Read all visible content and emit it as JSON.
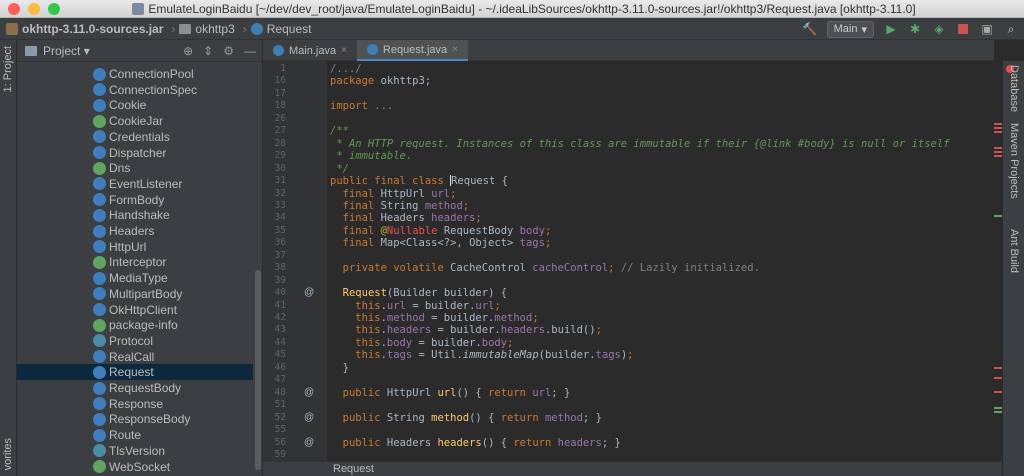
{
  "window": {
    "title": "EmulateLoginBaidu [~/dev/dev_root/java/EmulateLoginBaidu] - ~/.ideaLibSources/okhttp-3.11.0-sources.jar!/okhttp3/Request.java [okhttp-3.11.0]",
    "traffic_colors": [
      "#fc605c",
      "#fdbc40",
      "#34c84a"
    ]
  },
  "breadcrumbs": [
    "okhttp-3.11.0-sources.jar",
    "okhttp3",
    "Request"
  ],
  "toolbar": {
    "run_config": "Main",
    "icons": [
      "hammer-icon",
      "run-icon",
      "debug-icon",
      "coverage-icon",
      "stop-icon",
      "layout-icon",
      "search-icon"
    ]
  },
  "left_strip": {
    "project_tab": "1: Project",
    "favorites_tab": "vorites"
  },
  "project_panel": {
    "title": "Project",
    "items": [
      {
        "label": "ConnectionPool",
        "icon": "class-icon"
      },
      {
        "label": "ConnectionSpec",
        "icon": "class-icon"
      },
      {
        "label": "Cookie",
        "icon": "class-icon"
      },
      {
        "label": "CookieJar",
        "icon": "interface-icon"
      },
      {
        "label": "Credentials",
        "icon": "class-icon"
      },
      {
        "label": "Dispatcher",
        "icon": "class-icon"
      },
      {
        "label": "Dns",
        "icon": "interface-icon"
      },
      {
        "label": "EventListener",
        "icon": "class-icon"
      },
      {
        "label": "FormBody",
        "icon": "class-icon"
      },
      {
        "label": "Handshake",
        "icon": "class-icon"
      },
      {
        "label": "Headers",
        "icon": "class-icon"
      },
      {
        "label": "HttpUrl",
        "icon": "class-icon"
      },
      {
        "label": "Interceptor",
        "icon": "interface-icon"
      },
      {
        "label": "MediaType",
        "icon": "class-icon"
      },
      {
        "label": "MultipartBody",
        "icon": "class-icon"
      },
      {
        "label": "OkHttpClient",
        "icon": "class-icon"
      },
      {
        "label": "package-info",
        "icon": "interface-icon"
      },
      {
        "label": "Protocol",
        "icon": "enum-icon"
      },
      {
        "label": "RealCall",
        "icon": "class-icon"
      },
      {
        "label": "Request",
        "icon": "class-icon",
        "selected": true
      },
      {
        "label": "RequestBody",
        "icon": "class-icon"
      },
      {
        "label": "Response",
        "icon": "class-icon"
      },
      {
        "label": "ResponseBody",
        "icon": "class-icon"
      },
      {
        "label": "Route",
        "icon": "class-icon"
      },
      {
        "label": "TlsVersion",
        "icon": "enum-icon"
      },
      {
        "label": "WebSocket",
        "icon": "interface-icon"
      }
    ]
  },
  "tabs": [
    {
      "label": "Main.java",
      "active": false
    },
    {
      "label": "Request.java",
      "active": true
    }
  ],
  "editor": {
    "lines": [
      {
        "n": "1",
        "gutter": "",
        "tokens": [
          {
            "t": "/.../",
            "c": "cm"
          }
        ]
      },
      {
        "n": "16",
        "gutter": "",
        "tokens": [
          {
            "t": "package ",
            "c": "kw"
          },
          {
            "t": "okhttp3;",
            "c": ""
          }
        ]
      },
      {
        "n": "17",
        "gutter": "",
        "tokens": []
      },
      {
        "n": "18",
        "gutter": "",
        "tokens": [
          {
            "t": "import ",
            "c": "kw"
          },
          {
            "t": "...",
            "c": "cm"
          }
        ]
      },
      {
        "n": "26",
        "gutter": "",
        "tokens": []
      },
      {
        "n": "27",
        "gutter": "",
        "tokens": [
          {
            "t": "/**",
            "c": "doc"
          }
        ]
      },
      {
        "n": "28",
        "gutter": "",
        "tokens": [
          {
            "t": " * An HTTP request. Instances of this class are immutable if their {",
            "c": "doc"
          },
          {
            "t": "@link",
            "c": "doc"
          },
          {
            "t": " #body} is null or itself",
            "c": "doc"
          }
        ]
      },
      {
        "n": "29",
        "gutter": "",
        "tokens": [
          {
            "t": " * immutable.",
            "c": "doc"
          }
        ]
      },
      {
        "n": "30",
        "gutter": "",
        "tokens": [
          {
            "t": " */",
            "c": "doc"
          }
        ]
      },
      {
        "n": "31",
        "gutter": "",
        "tokens": [
          {
            "t": "public final class ",
            "c": "kw"
          },
          {
            "t": "Request {",
            "c": "caret"
          }
        ]
      },
      {
        "n": "32",
        "gutter": "",
        "tokens": [
          {
            "t": "  final ",
            "c": "kw"
          },
          {
            "t": "HttpUrl ",
            "c": ""
          },
          {
            "t": "url",
            "c": "fld"
          },
          {
            "t": ";",
            "c": "kw"
          }
        ]
      },
      {
        "n": "33",
        "gutter": "",
        "tokens": [
          {
            "t": "  final ",
            "c": "kw"
          },
          {
            "t": "String ",
            "c": ""
          },
          {
            "t": "method",
            "c": "fld"
          },
          {
            "t": ";",
            "c": "kw"
          }
        ]
      },
      {
        "n": "34",
        "gutter": "",
        "tokens": [
          {
            "t": "  final ",
            "c": "kw"
          },
          {
            "t": "Headers ",
            "c": ""
          },
          {
            "t": "headers",
            "c": "fld"
          },
          {
            "t": ";",
            "c": "kw"
          }
        ]
      },
      {
        "n": "35",
        "gutter": "",
        "tokens": [
          {
            "t": "  final ",
            "c": "kw"
          },
          {
            "t": "@",
            "c": "ann"
          },
          {
            "t": "Nullable ",
            "c": "err"
          },
          {
            "t": "RequestBody ",
            "c": ""
          },
          {
            "t": "body",
            "c": "fld"
          },
          {
            "t": ";",
            "c": "kw"
          }
        ]
      },
      {
        "n": "36",
        "gutter": "",
        "tokens": [
          {
            "t": "  final ",
            "c": "kw"
          },
          {
            "t": "Map<Class<?>, Object> ",
            "c": ""
          },
          {
            "t": "tags",
            "c": "fld"
          },
          {
            "t": ";",
            "c": "kw"
          }
        ]
      },
      {
        "n": "37",
        "gutter": "",
        "tokens": []
      },
      {
        "n": "38",
        "gutter": "",
        "tokens": [
          {
            "t": "  private volatile ",
            "c": "kw"
          },
          {
            "t": "CacheControl ",
            "c": ""
          },
          {
            "t": "cacheControl",
            "c": "fld"
          },
          {
            "t": "; ",
            "c": "kw"
          },
          {
            "t": "// Lazily initialized.",
            "c": "cm"
          }
        ]
      },
      {
        "n": "39",
        "gutter": "",
        "tokens": []
      },
      {
        "n": "40",
        "gutter": "@",
        "tokens": [
          {
            "t": "  ",
            "c": ""
          },
          {
            "t": "Request",
            "c": "fn"
          },
          {
            "t": "(Builder builder) {",
            "c": ""
          }
        ]
      },
      {
        "n": "41",
        "gutter": "",
        "tokens": [
          {
            "t": "    this",
            "c": "kw"
          },
          {
            "t": ".",
            "c": ""
          },
          {
            "t": "url",
            "c": "fld"
          },
          {
            "t": " = builder.",
            "c": ""
          },
          {
            "t": "url",
            "c": "fld"
          },
          {
            "t": ";",
            "c": "kw"
          }
        ]
      },
      {
        "n": "42",
        "gutter": "",
        "tokens": [
          {
            "t": "    this",
            "c": "kw"
          },
          {
            "t": ".",
            "c": ""
          },
          {
            "t": "method",
            "c": "fld"
          },
          {
            "t": " = builder.",
            "c": ""
          },
          {
            "t": "method",
            "c": "fld"
          },
          {
            "t": ";",
            "c": "kw"
          }
        ]
      },
      {
        "n": "43",
        "gutter": "",
        "tokens": [
          {
            "t": "    this",
            "c": "kw"
          },
          {
            "t": ".",
            "c": ""
          },
          {
            "t": "headers",
            "c": "fld"
          },
          {
            "t": " = builder.",
            "c": ""
          },
          {
            "t": "headers",
            "c": "fld"
          },
          {
            "t": ".build()",
            "c": ""
          },
          {
            "t": ";",
            "c": "kw"
          }
        ]
      },
      {
        "n": "44",
        "gutter": "",
        "tokens": [
          {
            "t": "    this",
            "c": "kw"
          },
          {
            "t": ".",
            "c": ""
          },
          {
            "t": "body",
            "c": "fld"
          },
          {
            "t": " = builder.",
            "c": ""
          },
          {
            "t": "body",
            "c": "fld"
          },
          {
            "t": ";",
            "c": "kw"
          }
        ]
      },
      {
        "n": "45",
        "gutter": "",
        "tokens": [
          {
            "t": "    this",
            "c": "kw"
          },
          {
            "t": ".",
            "c": ""
          },
          {
            "t": "tags",
            "c": "fld"
          },
          {
            "t": " = Util.",
            "c": ""
          },
          {
            "t": "immutableMap",
            "c": "itl"
          },
          {
            "t": "(builder.",
            "c": ""
          },
          {
            "t": "tags",
            "c": "fld"
          },
          {
            "t": ")",
            "c": ""
          },
          {
            "t": ";",
            "c": "kw"
          }
        ]
      },
      {
        "n": "46",
        "gutter": "",
        "tokens": [
          {
            "t": "  }",
            "c": ""
          }
        ]
      },
      {
        "n": "47",
        "gutter": "",
        "tokens": []
      },
      {
        "n": "48",
        "gutter": "@",
        "tokens": [
          {
            "t": "  public ",
            "c": "kw"
          },
          {
            "t": "HttpUrl ",
            "c": ""
          },
          {
            "t": "url",
            "c": "fn"
          },
          {
            "t": "() { ",
            "c": ""
          },
          {
            "t": "return ",
            "c": "kw"
          },
          {
            "t": "url",
            "c": "fld"
          },
          {
            "t": "; }",
            "c": ""
          }
        ]
      },
      {
        "n": "51",
        "gutter": "",
        "tokens": []
      },
      {
        "n": "52",
        "gutter": "@",
        "tokens": [
          {
            "t": "  public ",
            "c": "kw"
          },
          {
            "t": "String ",
            "c": ""
          },
          {
            "t": "method",
            "c": "fn"
          },
          {
            "t": "() { ",
            "c": ""
          },
          {
            "t": "return ",
            "c": "kw"
          },
          {
            "t": "method",
            "c": "fld"
          },
          {
            "t": "; }",
            "c": ""
          }
        ]
      },
      {
        "n": "55",
        "gutter": "",
        "tokens": []
      },
      {
        "n": "56",
        "gutter": "@",
        "tokens": [
          {
            "t": "  public ",
            "c": "kw"
          },
          {
            "t": "Headers ",
            "c": ""
          },
          {
            "t": "headers",
            "c": "fn"
          },
          {
            "t": "() { ",
            "c": ""
          },
          {
            "t": "return ",
            "c": "kw"
          },
          {
            "t": "headers",
            "c": "fld"
          },
          {
            "t": "; }",
            "c": ""
          }
        ]
      },
      {
        "n": "59",
        "gutter": "",
        "tokens": []
      }
    ]
  },
  "right_strip": {
    "tabs": [
      "Database",
      "Maven Projects",
      "Ant Build"
    ]
  },
  "status": {
    "breadcrumb": "Request"
  }
}
